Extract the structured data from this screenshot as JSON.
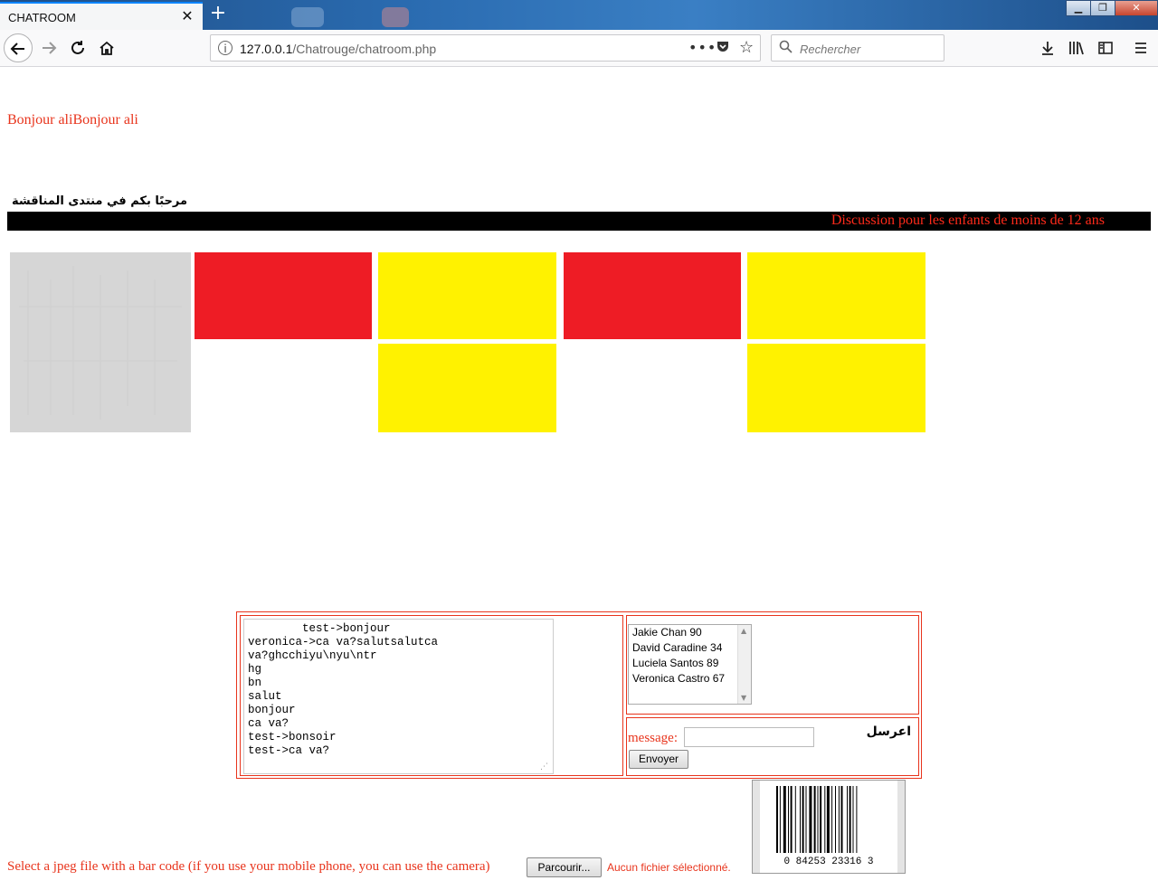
{
  "browser": {
    "tab_title": "CHATROOM",
    "tab_close_glyph": "✕",
    "new_tab_glyph": "+",
    "url_host": "127.0.0.1",
    "url_path": "/Chatrouge/chatroom.php",
    "url_more_glyph": "•••",
    "search_placeholder": "Rechercher",
    "window_controls": [
      "▁",
      "❐",
      "✕"
    ],
    "icons": [
      "back-icon",
      "forward-icon",
      "reload-icon",
      "home-icon",
      "info-icon",
      "pocket-icon",
      "bookmark-star-icon",
      "search-icon",
      "download-icon",
      "library-icon",
      "sidebar-icon",
      "menu-icon"
    ]
  },
  "page": {
    "greeting": "Bonjour aliBonjour ali",
    "arabic_title": "مرحبًا بكم في منتدى المناقشة",
    "discussion_banner": "Discussion pour les enfants de moins de 12 ans",
    "colors": {
      "accent_red": "#e8341c",
      "tile_red": "#ee1c25",
      "tile_yellow": "#fff200",
      "banner_bg": "#000000"
    },
    "tiles": [
      {
        "color": "red"
      },
      {
        "color": "yellow"
      },
      {
        "color": "yellow"
      },
      {
        "color": "red"
      },
      {
        "color": "yellow"
      },
      {
        "color": "yellow"
      }
    ]
  },
  "chat": {
    "log": "        test->bonjour\nveronica->ca va?salutsalutca\nva?ghcchiyu\\nyu\\ntr\nhg\nbn\nsalut\nbonjour\nca va?\ntest->bonsoir\ntest->ca va?",
    "users": [
      "Jakie Chan 90",
      "David Caradine 34",
      "Luciela Santos 89",
      "Veronica Castro 67"
    ],
    "message_label": "message:",
    "message_value": "",
    "arabic_send_label": "اعرسل",
    "send_button": "Envoyer"
  },
  "upload": {
    "label": "Select a jpeg file with a bar code (if you use your mobile phone, you can use the camera)",
    "browse_button": "Parcourir...",
    "status": "Aucun fichier sélectionné.",
    "barcode_digits": "0  84253  23316  3"
  }
}
